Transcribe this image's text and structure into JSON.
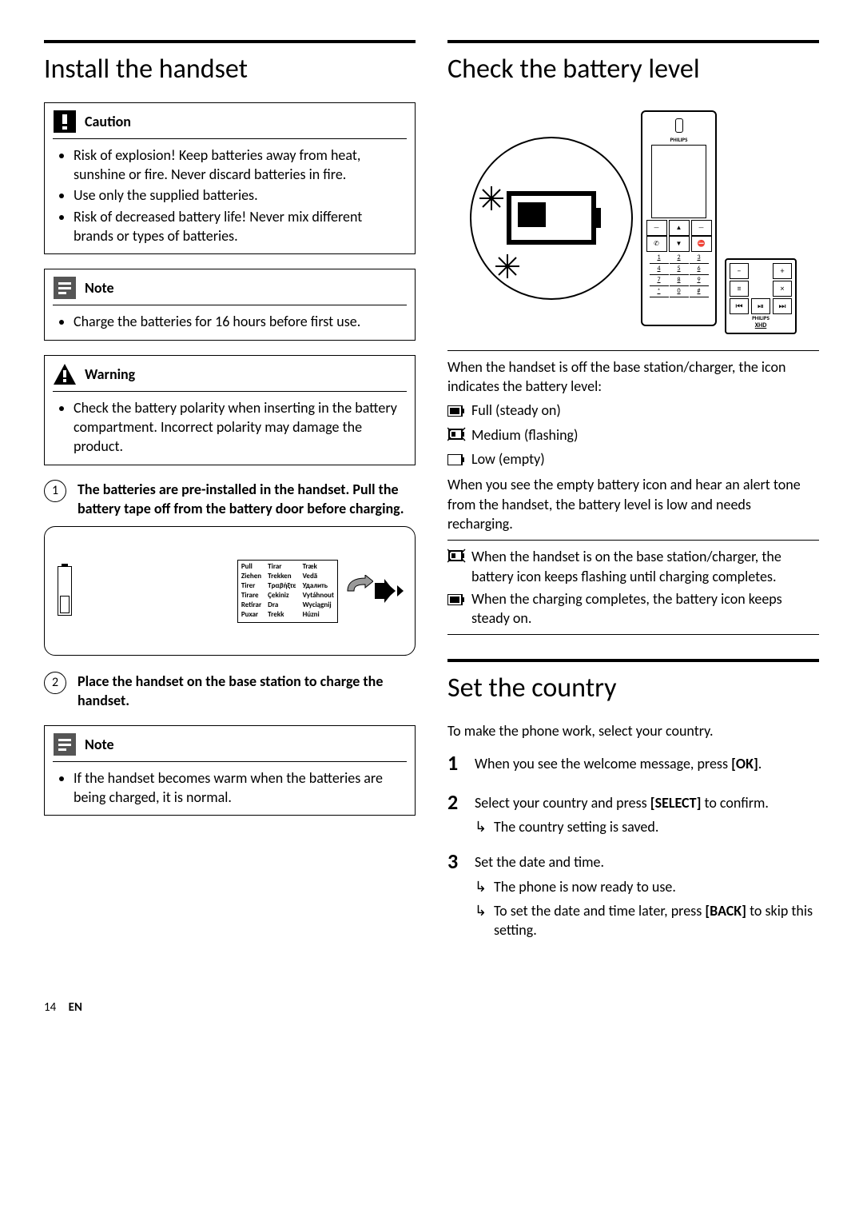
{
  "left": {
    "title": "Install the handset",
    "caution": {
      "label": "Caution",
      "items": [
        "Risk of explosion! Keep batteries away from heat, sunshine or fire. Never discard batteries in fire.",
        "Use only the supplied batteries.",
        "Risk of decreased battery life! Never mix different brands or types of batteries."
      ]
    },
    "note1": {
      "label": "Note",
      "items": [
        "Charge the batteries for 16 hours before first use."
      ]
    },
    "warning": {
      "label": "Warning",
      "items": [
        "Check the battery polarity when inserting in the battery compartment. Incorrect polarity may damage the product."
      ]
    },
    "step1": "The batteries are pre-installed in the handset. Pull the battery tape off from the battery door before charging.",
    "pull_words": [
      "Pull",
      "Tirar",
      "Træk",
      "Ziehen",
      "Trekken",
      "Vedä",
      "Tirer",
      "Τραβήξτε",
      "Удалить",
      "Tirare",
      "Çekiniz",
      "Vytáhnout",
      "Retirar",
      "Dra",
      "Wyciągnij",
      "Puxar",
      "Trekk",
      "Húzni"
    ],
    "step2": "Place the handset on the base station to charge the handset.",
    "note2": {
      "label": "Note",
      "items": [
        "If the handset becomes warm when the batteries are being charged, it is normal."
      ]
    }
  },
  "right": {
    "title1": "Check the battery level",
    "brand": "PHILIPS",
    "xhd": "XHD",
    "keys": [
      "1",
      "2",
      "3",
      "4",
      "5",
      "6",
      "7",
      "8",
      "9",
      "*",
      "0",
      "#"
    ],
    "intro": "When the handset is off the base station/charger, the icon indicates the battery level:",
    "full": "Full (steady on)",
    "medium": "Medium (flashing)",
    "low": "Low (empty)",
    "low_desc": "When you see the empty battery icon and hear an alert tone from the handset, the battery level is low and needs recharging.",
    "charging": "When the handset is on the base station/charger, the battery icon keeps flashing until charging completes.",
    "done": "When the charging completes, the battery icon keeps steady on.",
    "title2": "Set the country",
    "sc_intro": "To make the phone work, select your country.",
    "s1a": "When you see the welcome message, press ",
    "s1b": "[OK]",
    "s1c": ".",
    "s2a": "Select your country and press ",
    "s2b": "[SELECT]",
    "s2c": " to confirm.",
    "s2r": "The country setting is saved.",
    "s3": "Set the date and time.",
    "s3r1": "The phone is now ready to use.",
    "s3r2a": "To set the date and time later, press ",
    "s3r2b": "[BACK]",
    "s3r2c": " to skip this setting."
  },
  "footer": {
    "page": "14",
    "lang": "EN"
  }
}
